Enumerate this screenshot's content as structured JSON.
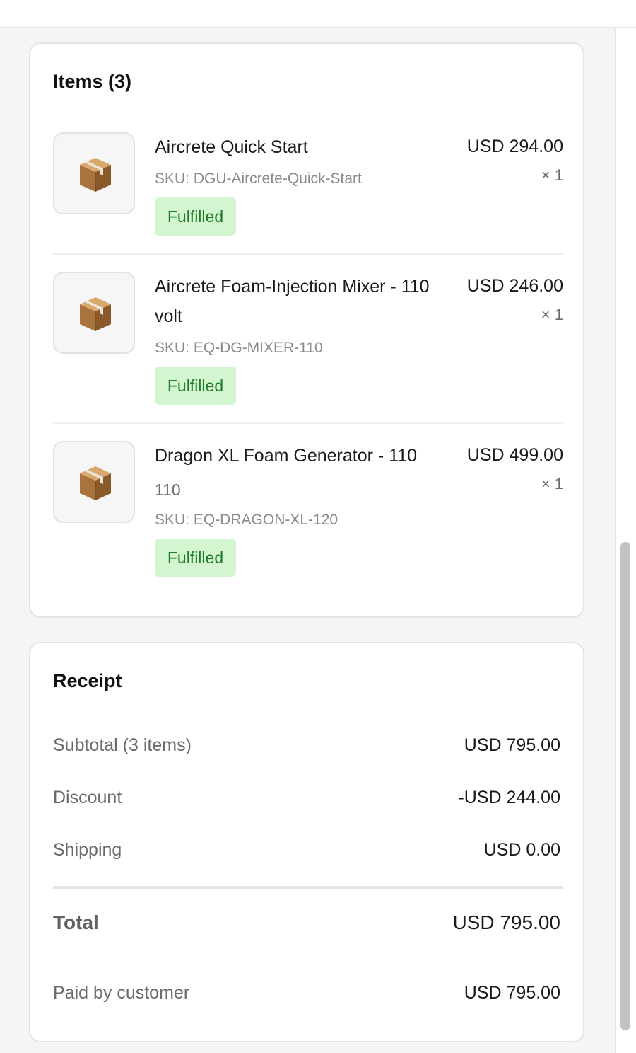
{
  "items_card": {
    "title": "Items (3)",
    "items": [
      {
        "name": "Aircrete Quick Start",
        "variant": "",
        "sku": "SKU: DGU-Aircrete-Quick-Start",
        "status": "Fulfilled",
        "price": "USD 294.00",
        "qty": "× 1",
        "icon": "package-icon"
      },
      {
        "name": "Aircrete Foam-Injection Mixer - 110 volt",
        "variant": "",
        "sku": "SKU: EQ-DG-MIXER-110",
        "status": "Fulfilled",
        "price": "USD 246.00",
        "qty": "× 1",
        "icon": "package-icon"
      },
      {
        "name": "Dragon XL Foam Generator - 110",
        "variant": "110",
        "sku": "SKU: EQ-DRAGON-XL-120",
        "status": "Fulfilled",
        "price": "USD 499.00",
        "qty": "× 1",
        "icon": "package-icon"
      }
    ]
  },
  "receipt": {
    "title": "Receipt",
    "subtotal_label": "Subtotal (3 items)",
    "subtotal_value": "USD 795.00",
    "discount_label": "Discount",
    "discount_value": "-USD 244.00",
    "shipping_label": "Shipping",
    "shipping_value": "USD 0.00",
    "total_label": "Total",
    "total_value": "USD 795.00",
    "paid_label": "Paid by customer",
    "paid_value": "USD 795.00"
  },
  "colors": {
    "badge_bg": "#d3f5d0",
    "badge_text": "#1f7a2a"
  }
}
